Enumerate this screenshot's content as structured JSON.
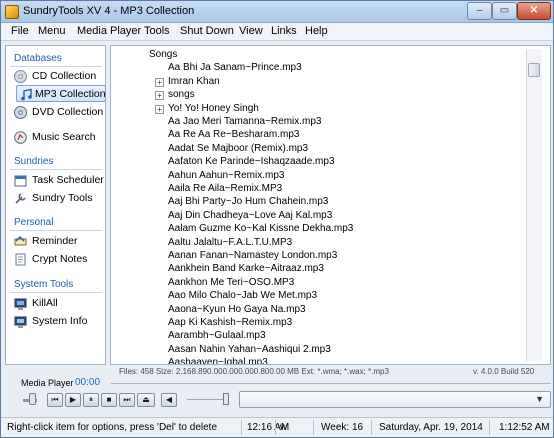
{
  "window": {
    "title": "SundryTools XV 4 - MP3 Collection",
    "minimize": "–",
    "maximize": "▭",
    "close": "✕"
  },
  "menu": [
    "File",
    "Menu",
    "Media Player",
    "Tools",
    "Shut Down",
    "View",
    "Links",
    "Help"
  ],
  "sidebar": {
    "sections": [
      "Databases",
      "Sundries",
      "Personal",
      "System Tools"
    ],
    "items": [
      {
        "label": "CD Collection",
        "icon": "cd-icon"
      },
      {
        "label": "MP3 Collection",
        "icon": "mp3-icon",
        "selected": true
      },
      {
        "label": "DVD Collection",
        "icon": "dvd-icon"
      },
      {
        "label": "Music Search",
        "icon": "music-search-icon"
      },
      {
        "label": "Task Scheduler",
        "icon": "calendar-icon"
      },
      {
        "label": "Sundry Tools",
        "icon": "tools-icon"
      },
      {
        "label": "Reminder",
        "icon": "reminder-icon"
      },
      {
        "label": "Crypt Notes",
        "icon": "notes-icon"
      },
      {
        "label": "KillAll",
        "icon": "killall-icon"
      },
      {
        "label": "System Info",
        "icon": "system-info-icon"
      }
    ]
  },
  "tree": {
    "root": "Songs",
    "items": [
      {
        "label": "Aa Bhi Ja Sanam~Prince.mp3",
        "expandable": false
      },
      {
        "label": "Imran Khan",
        "expandable": true
      },
      {
        "label": "songs",
        "expandable": true
      },
      {
        "label": "Yo! Yo! Honey Singh",
        "expandable": true
      },
      {
        "label": "Aa Jao Meri Tamanna~Remix.mp3",
        "expandable": false
      },
      {
        "label": "Aa Re Aa Re~Besharam.mp3",
        "expandable": false
      },
      {
        "label": "Aadat Se Majboor (Remix).mp3",
        "expandable": false
      },
      {
        "label": "Aafaton Ke Parinde~Ishaqzaade.mp3",
        "expandable": false
      },
      {
        "label": "Aahun Aahun~Remix.mp3",
        "expandable": false
      },
      {
        "label": "Aaila Re Aila~Remix.MP3",
        "expandable": false
      },
      {
        "label": "Aaj Bhi Party~Jo Hum Chahein.mp3",
        "expandable": false
      },
      {
        "label": "Aaj Din Chadheya~Love Aaj Kal.mp3",
        "expandable": false
      },
      {
        "label": "Aalam Guzme Ko~Kal Kissne Dekha.mp3",
        "expandable": false
      },
      {
        "label": "Aaltu Jalaltu~F.A.L.T.U.MP3",
        "expandable": false
      },
      {
        "label": "Aanan Fanan~Namastey London.mp3",
        "expandable": false
      },
      {
        "label": "Aankhein Band Karke~Aitraaz.mp3",
        "expandable": false
      },
      {
        "label": "Aankhon Me Teri~OSO.MP3",
        "expandable": false
      },
      {
        "label": "Aao Milo Chalo~Jab We Met.mp3",
        "expandable": false
      },
      {
        "label": "Aaona~Kyun Ho Gaya Na.mp3",
        "expandable": false
      },
      {
        "label": "Aap Ki Kashish~Remix.mp3",
        "expandable": false
      },
      {
        "label": "Aarambh~Gulaal.mp3",
        "expandable": false
      },
      {
        "label": "Aasan Nahin Yahan~Aashiqui 2.mp3",
        "expandable": false
      },
      {
        "label": "Aashaayen~Iqbal.mp3",
        "expandable": false
      }
    ]
  },
  "files_status": "Files: 458 Size: 2.168.890.000.000.000.800.00 MB Ext: *.wma; *.wax; *.mp3",
  "version": "v. 4.0.0 Build 520",
  "player": {
    "label": "Media Player",
    "time": "00:00",
    "progress": 0,
    "volume_level": 0.5
  },
  "transport": [
    "prev-icon",
    "play-icon",
    "pause-icon",
    "stop-icon",
    "next-icon",
    "eject-icon",
    "mute-icon"
  ],
  "statusbar": {
    "hint": "Right-click item for options, press 'Del' to delete",
    "time": "12:16 AM",
    "week_abbr": "w",
    "week": "Week: 16",
    "date": "Saturday, Apr. 19, 2014",
    "clock": "1:12:52 AM"
  }
}
